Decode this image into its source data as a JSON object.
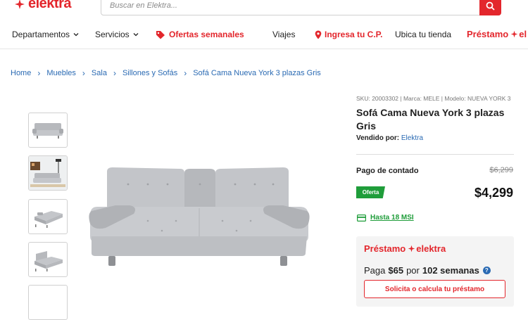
{
  "header": {
    "logo_text": "elektra",
    "search_placeholder": "Buscar en Elektra...",
    "brand_color": "#e3262c"
  },
  "nav": {
    "departamentos": "Departamentos",
    "servicios": "Servicios",
    "ofertas": "Ofertas semanales",
    "viajes": "Viajes",
    "ingresa_cp": "Ingresa tu C.P.",
    "ubica": "Ubica tu tienda",
    "prestamo": "Préstamo",
    "prestamo_brand": "el"
  },
  "breadcrumb": [
    "Home",
    "Muebles",
    "Sala",
    "Sillones y Sofás",
    "Sofá Cama Nueva York 3 plazas Gris"
  ],
  "product": {
    "sku_line": "SKU: 20003302 | Marca: MELE | Modelo: NUEVA YORK 3",
    "title": "Sofá Cama Nueva York 3 plazas Gris",
    "sold_by_label": "Vendido por:",
    "seller": "Elektra",
    "payment_label": "Pago de contado",
    "old_price": "$6,299",
    "offer_badge": "Oferta",
    "price": "$4,299",
    "msi_link": "Hasta 18 MSI",
    "thumbnails": [
      "sofa-front",
      "sofa-room",
      "sofa-bed-open",
      "sofa-side"
    ]
  },
  "loan": {
    "brand_prefix": "Préstamo",
    "brand_suffix": "elektra",
    "pay_label": "Paga",
    "pay_amount": "$65",
    "per_label": "por",
    "weeks": "102 semanas",
    "cta": "Solicita o calcula tu préstamo"
  }
}
